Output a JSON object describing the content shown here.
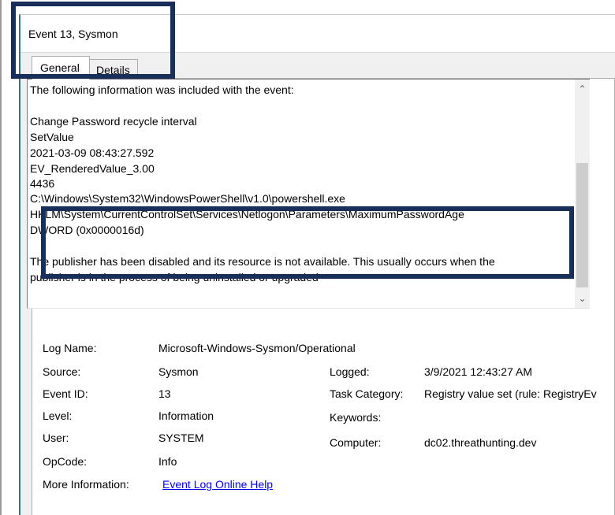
{
  "window": {
    "title": "Event 13, Sysmon"
  },
  "tabs": [
    {
      "label": "General",
      "selected": true
    },
    {
      "label": "Details",
      "selected": false
    }
  ],
  "description": {
    "intro": "The following information was included with the event:",
    "lines": [
      "Change Password recycle interval",
      "SetValue",
      "2021-03-09 08:43:27.592",
      "EV_RenderedValue_3.00",
      "4436",
      "C:\\Windows\\System32\\WindowsPowerShell\\v1.0\\powershell.exe",
      "HKLM\\System\\CurrentControlSet\\Services\\Netlogon\\Parameters\\MaximumPasswordAge",
      "DWORD (0x0000016d)"
    ],
    "publisher_message_1": "The publisher has been disabled and its resource is not available. This usually occurs when the",
    "publisher_message_2": "publisher is in the process of being uninstalled or upgraded"
  },
  "properties": {
    "log_name_label": "Log Name:",
    "log_name_value": "Microsoft-Windows-Sysmon/Operational",
    "source_label": "Source:",
    "source_value": "Sysmon",
    "logged_label": "Logged:",
    "logged_value": "3/9/2021 12:43:27 AM",
    "event_id_label": "Event ID:",
    "event_id_value": "13",
    "task_category_label": "Task Category:",
    "task_category_value": "Registry value set (rule: RegistryEv",
    "level_label": "Level:",
    "level_value": "Information",
    "keywords_label": "Keywords:",
    "keywords_value": "",
    "user_label": "User:",
    "user_value": "SYSTEM",
    "computer_label": "Computer:",
    "computer_value": "dc02.threathunting.dev",
    "opcode_label": "OpCode:",
    "opcode_value": "Info",
    "more_info_label": "More Information:",
    "more_info_link": "Event Log Online Help"
  },
  "icons": {
    "scroll_up": "chevron-up-icon",
    "scroll_down": "chevron-down-icon"
  },
  "colors": {
    "highlight": "#1a2e5c",
    "link": "#0000ee",
    "window_accent": "#2b7a8c"
  }
}
